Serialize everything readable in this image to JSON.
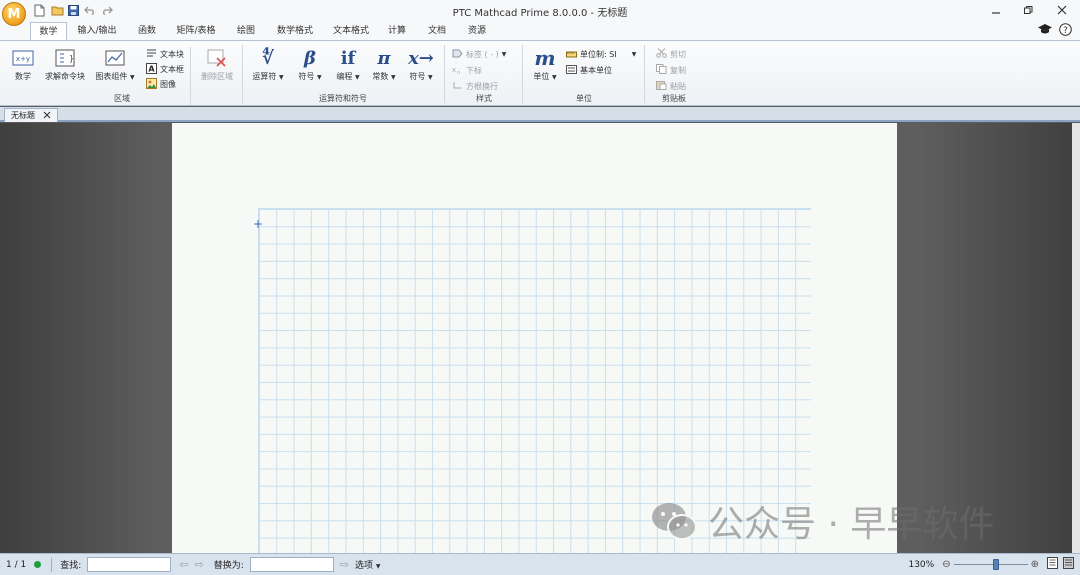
{
  "titlebar": {
    "logo_letter": "M",
    "title": "PTC Mathcad Prime 8.0.0.0 - 无标题"
  },
  "tabs": [
    "数学",
    "输入/输出",
    "函数",
    "矩阵/表格",
    "绘图",
    "数学格式",
    "文本格式",
    "计算",
    "文档",
    "资源"
  ],
  "ribbon": {
    "regions": {
      "math_label": "数学",
      "solve_block_label": "求解命令块",
      "chart_component_label": "图表组件",
      "text_block_label": "文本块",
      "text_box_label": "文本框",
      "image_label": "图像",
      "delete_region_label": "删除区域",
      "group_label": "区域"
    },
    "operators": {
      "operators_label": "运算符",
      "symbols_label": "符号",
      "programming_label": "编程",
      "constants_label": "常数",
      "symbolics_label": "符号",
      "group_label": "运算符和符号",
      "icon_operators": "∜",
      "icon_symbols": "β",
      "icon_programming": "if",
      "icon_constants": "π",
      "icon_symbolics": "x→"
    },
    "style": {
      "label_combo": "标签 ( - )",
      "subscript": "下标",
      "matrix_wrap": "方根换行",
      "group_label": "样式"
    },
    "units": {
      "units_label": "单位",
      "icon_units": "m",
      "unit_system": "单位制: SI",
      "base_units": "基本单位",
      "group_label": "单位"
    },
    "clipboard": {
      "cut": "剪切",
      "copy": "复制",
      "paste": "粘贴",
      "group_label": "剪贴板"
    }
  },
  "document": {
    "tab_title": "无标题",
    "watermark": "公众号 · 早早软件"
  },
  "statusbar": {
    "page": "1 / 1",
    "find_label": "查找:",
    "replace_label": "替换为:",
    "options_label": "选项",
    "zoom": "130%",
    "zoom_level": 0.6,
    "status_color": "#1e9e3a"
  }
}
